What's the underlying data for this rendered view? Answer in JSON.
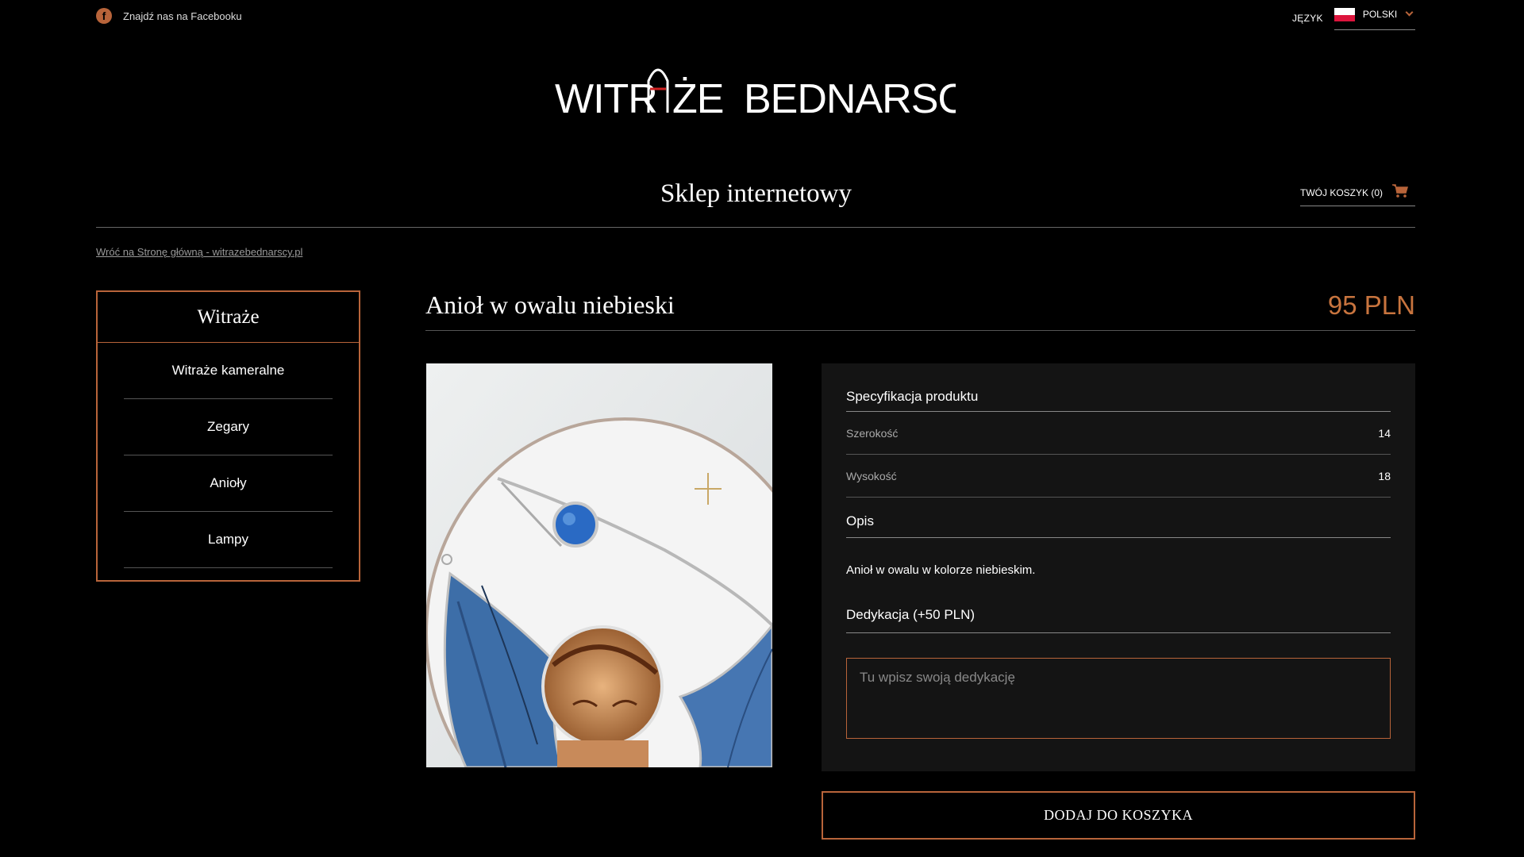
{
  "topbar": {
    "facebook_label": "Znajdź nas na Facebooku",
    "language_label": "JĘZYK",
    "language_value": "POLSKI"
  },
  "logo": {
    "text": "WITRAŻE BEDNARSCY"
  },
  "shop": {
    "title": "Sklep internetowy",
    "cart_label": "TWÓJ KOSZYK (0)",
    "back_link": "Wróć na Stronę główną - witrazebednarscy.pl"
  },
  "sidebar": {
    "heading": "Witraże",
    "items": [
      {
        "label": "Witraże kameralne"
      },
      {
        "label": "Zegary"
      },
      {
        "label": "Anioły"
      },
      {
        "label": "Lampy"
      }
    ]
  },
  "product": {
    "title": "Anioł w owalu niebieski",
    "price": "95 PLN",
    "spec_heading": "Specyfikacja produktu",
    "specs": [
      {
        "key": "Szerokość",
        "value": "14"
      },
      {
        "key": "Wysokość",
        "value": "18"
      }
    ],
    "description_heading": "Opis",
    "description": "Anioł w owalu w kolorze niebieskim.",
    "dedication_heading": "Dedykacja (+50 PLN)",
    "dedication_placeholder": "Tu wpisz swoją dedykację",
    "add_to_cart": "DODAJ DO KOSZYKA"
  },
  "colors": {
    "accent": "#b8643a",
    "price": "#c8743e",
    "panel": "#141414",
    "background": "#000000"
  },
  "icons": [
    "facebook-icon",
    "poland-flag-icon",
    "chevron-down-icon",
    "cart-icon"
  ]
}
